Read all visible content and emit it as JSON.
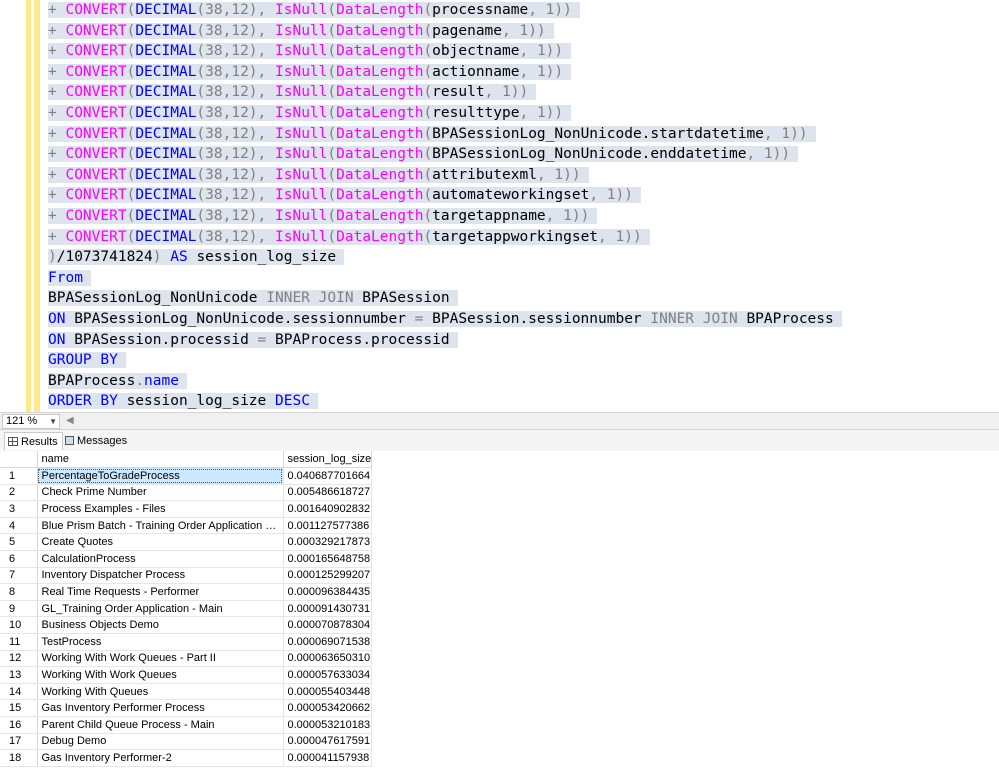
{
  "editor": {
    "lines": [
      {
        "prefix": "+ ",
        "column": "processname",
        "suffix": ", 1))"
      },
      {
        "prefix": "+ ",
        "column": "pagename",
        "suffix": ", 1))"
      },
      {
        "prefix": "+ ",
        "column": "objectname",
        "suffix": ", 1))"
      },
      {
        "prefix": "+ ",
        "column": "actionname",
        "suffix": ", 1))"
      },
      {
        "prefix": "+ ",
        "column": "result",
        "suffix": ", 1))"
      },
      {
        "prefix": "+ ",
        "column": "resulttype",
        "suffix": ", 1))"
      },
      {
        "prefix": "+ ",
        "column": "BPASessionLog_NonUnicode.startdatetime",
        "suffix": ", 1))"
      },
      {
        "prefix": "+ ",
        "column": "BPASessionLog_NonUnicode.enddatetime",
        "suffix": ", 1))"
      },
      {
        "prefix": "+ ",
        "column": "attributexml",
        "suffix": ", 1))"
      },
      {
        "prefix": "+ ",
        "column": "automateworkingset",
        "suffix": ", 1))"
      },
      {
        "prefix": "+ ",
        "column": "targetappname",
        "suffix": ", 1))"
      },
      {
        "prefix": "+ ",
        "column": "targetappworkingset",
        "suffix": ", 1))"
      }
    ],
    "tokens": {
      "convert": "CONVERT",
      "decimal": "DECIMAL",
      "precision": "(38,12)",
      "isnull": "IsNull",
      "datalength": "DataLength"
    },
    "closing_line": {
      "paren": ")",
      "divisor": "/1073741824",
      "paren2": ")",
      "as_kw": "AS",
      "alias": "session_log_size"
    },
    "from_kw": "From",
    "join_line": {
      "table1": "BPASessionLog_NonUnicode",
      "join_kw": "INNER JOIN",
      "table2": "BPASession"
    },
    "on_line1": {
      "on_kw": "ON",
      "left": "BPASessionLog_NonUnicode.sessionnumber",
      "eq": "=",
      "right": "BPASession.sessionnumber",
      "join_kw": "INNER JOIN",
      "table3": "BPAProcess"
    },
    "on_line2": {
      "on_kw": "ON",
      "left": "BPASession.processid",
      "eq": "=",
      "right": "BPAProcess.processid"
    },
    "group_kw": "GROUP BY",
    "group_col": {
      "table": "BPAProcess",
      "dot": ".",
      "col": "name"
    },
    "order_line": {
      "order_kw": "ORDER BY",
      "col": "session_log_size",
      "desc_kw": "DESC"
    }
  },
  "zoom": {
    "value": "121 %"
  },
  "tabs": [
    {
      "label": "Results",
      "icon": "grid-icon"
    },
    {
      "label": "Messages",
      "icon": "messages-icon"
    }
  ],
  "results": {
    "columns": [
      "name",
      "session_log_size"
    ],
    "rows": [
      {
        "n": "1",
        "name": "PercentageToGradeProcess",
        "size": "0.040687701664"
      },
      {
        "n": "2",
        "name": "Check Prime Number",
        "size": "0.005486618727"
      },
      {
        "n": "3",
        "name": "Process Examples - Files",
        "size": "0.001640902832"
      },
      {
        "n": "4",
        "name": "Blue Prism Batch - Training Order Application Pr...",
        "size": "0.001127577386"
      },
      {
        "n": "5",
        "name": "Create Quotes",
        "size": "0.000329217873"
      },
      {
        "n": "6",
        "name": "CalculationProcess",
        "size": "0.000165648758"
      },
      {
        "n": "7",
        "name": "Inventory Dispatcher Process",
        "size": "0.000125299207"
      },
      {
        "n": "8",
        "name": "Real Time Requests - Performer",
        "size": "0.000096384435"
      },
      {
        "n": "9",
        "name": "GL_Training Order Application - Main",
        "size": "0.000091430731"
      },
      {
        "n": "10",
        "name": "Business Objects Demo",
        "size": "0.000070878304"
      },
      {
        "n": "11",
        "name": "TestProcess",
        "size": "0.000069071538"
      },
      {
        "n": "12",
        "name": "Working With Work Queues - Part II",
        "size": "0.000063650310"
      },
      {
        "n": "13",
        "name": "Working With Work Queues",
        "size": "0.000057633034"
      },
      {
        "n": "14",
        "name": "Working With Queues",
        "size": "0.000055403448"
      },
      {
        "n": "15",
        "name": "Gas Inventory Performer Process",
        "size": "0.000053420662"
      },
      {
        "n": "16",
        "name": "Parent Child Queue Process - Main",
        "size": "0.000053210183"
      },
      {
        "n": "17",
        "name": "Debug Demo",
        "size": "0.000047617591"
      },
      {
        "n": "18",
        "name": "Gas Inventory Performer-2",
        "size": "0.000041157938"
      }
    ]
  }
}
